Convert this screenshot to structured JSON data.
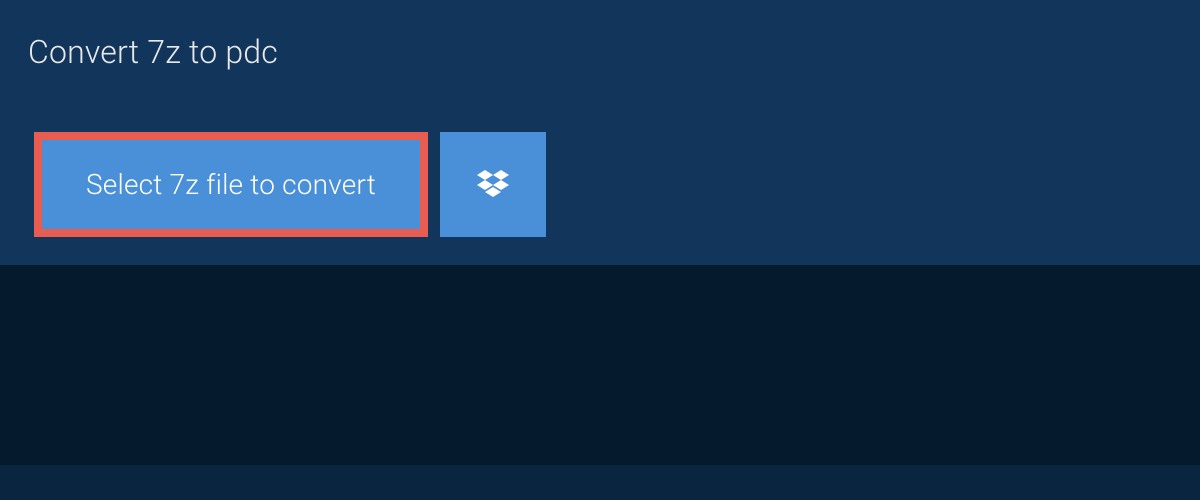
{
  "tab": {
    "label": "Convert 7z to pdc"
  },
  "actions": {
    "select_file_label": "Select 7z file to convert",
    "dropbox_icon": "dropbox-icon"
  },
  "colors": {
    "background_dark": "#0a2540",
    "panel": "#12355b",
    "button_primary": "#4a90d9",
    "highlight_border": "#e85d50",
    "lower_region": "#061a2e"
  }
}
